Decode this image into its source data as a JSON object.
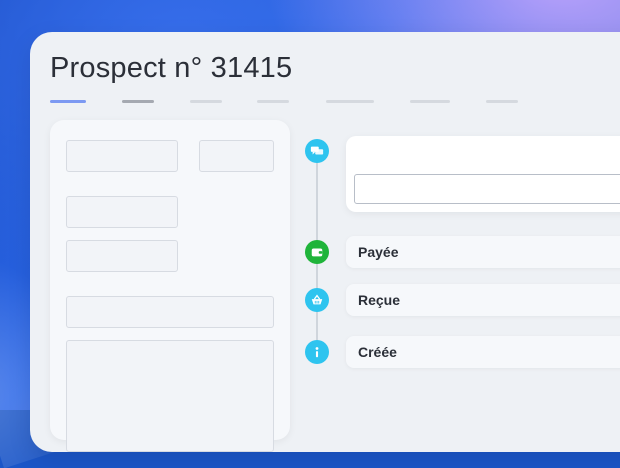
{
  "page": {
    "title": "Prospect n° 31415"
  },
  "tabs": {
    "count": 7,
    "active_index": 0
  },
  "timeline": {
    "items": [
      {
        "icon": "chat-icon",
        "color": "#2ec4ef",
        "label": ""
      },
      {
        "icon": "wallet-icon",
        "color": "#1fb43a",
        "label": "Payée"
      },
      {
        "icon": "basket-icon",
        "color": "#2ec4ef",
        "label": "Reçue"
      },
      {
        "icon": "info-icon",
        "color": "#2ec4ef",
        "label": "Créée"
      }
    ]
  }
}
